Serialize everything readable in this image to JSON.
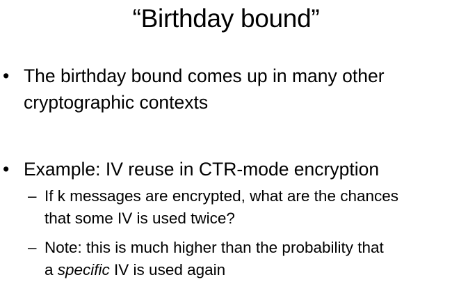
{
  "slide": {
    "title": "“Birthday bound”",
    "bullets": [
      {
        "marker": "•",
        "line1": "The birthday bound comes up in many other",
        "line2": "cryptographic contexts"
      },
      {
        "marker": "•",
        "line1": "Example: IV reuse in CTR-mode encryption",
        "subbullets": [
          {
            "marker": "–",
            "line1": "If k messages are encrypted, what are the chances",
            "line2": "that some IV is used twice?"
          },
          {
            "marker": "–",
            "line1": "Note: this is much higher than the probability that",
            "line2_prefix": "a ",
            "line2_emphasis": "specific",
            "line2_suffix": " IV is used again"
          }
        ]
      }
    ]
  }
}
